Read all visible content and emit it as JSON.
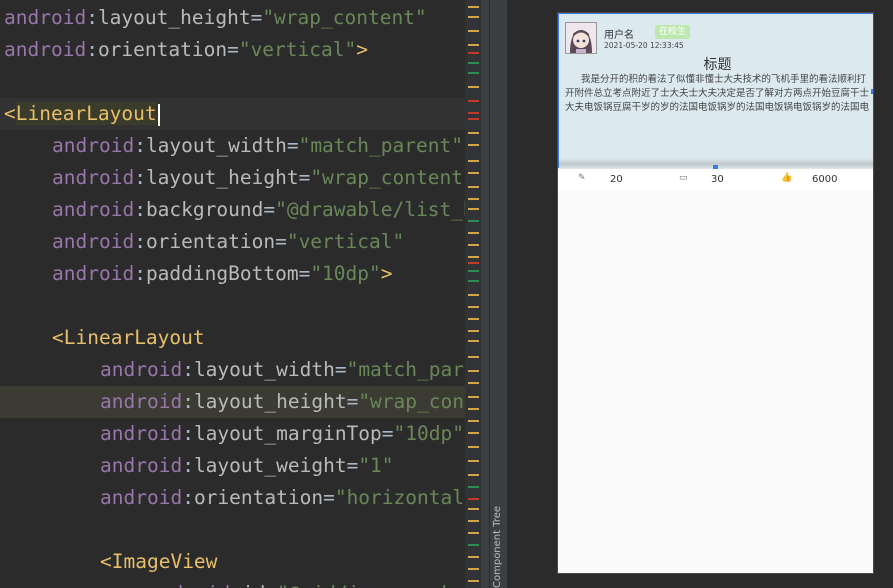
{
  "editor": {
    "lines": [
      {
        "indent": 0,
        "ns": "android",
        "attr": "layout_height",
        "value": "\"wrap_content\"",
        "end": ""
      },
      {
        "indent": 0,
        "ns": "android",
        "attr": "orientation",
        "value": "\"vertical\"",
        "end": ">"
      },
      {
        "indent": 0,
        "blank": true
      },
      {
        "indent": 0,
        "tag": "LinearLayout",
        "open": "<"
      },
      {
        "indent": 1,
        "ns": "android",
        "attr": "layout_width",
        "value": "\"match_parent\"",
        "end": ""
      },
      {
        "indent": 1,
        "ns": "android",
        "attr": "layout_height",
        "value": "\"wrap_content\"",
        "end": ""
      },
      {
        "indent": 1,
        "ns": "android",
        "attr": "background",
        "value": "\"@drawable/list_b",
        "end": ""
      },
      {
        "indent": 1,
        "ns": "android",
        "attr": "orientation",
        "value": "\"vertical\"",
        "end": ""
      },
      {
        "indent": 1,
        "ns": "android",
        "attr": "paddingBottom",
        "value": "\"10dp\"",
        "end": ">"
      },
      {
        "indent": 1,
        "blank": true
      },
      {
        "indent": 1,
        "tag": "LinearLayout",
        "open": "<"
      },
      {
        "indent": 2,
        "ns": "android",
        "attr": "layout_width",
        "value": "\"match_pare",
        "end": ""
      },
      {
        "indent": 2,
        "ns": "android",
        "attr": "layout_height",
        "value": "\"wrap_cont",
        "end": ""
      },
      {
        "indent": 2,
        "ns": "android",
        "attr": "layout_marginTop",
        "value": "\"10dp\"",
        "end": ""
      },
      {
        "indent": 2,
        "ns": "android",
        "attr": "layout_weight",
        "value": "\"1\"",
        "end": ""
      },
      {
        "indent": 2,
        "ns": "android",
        "attr": "orientation",
        "value": "\"horizontal\"",
        "end": ""
      },
      {
        "indent": 2,
        "blank": true
      },
      {
        "indent": 2,
        "tag": "ImageView",
        "open": "<"
      },
      {
        "indent": 3,
        "ns": "android",
        "attr": "id",
        "value": "\"@+id/iv_user_head\"",
        "end": ""
      }
    ]
  },
  "component_tree_label": "Component Tree",
  "card": {
    "username": "用户名",
    "badge": "在校生",
    "timestamp": "2021-05-20 12:33:45",
    "title": "标题",
    "body": "我是分开的积的看法了似懂非懂士大夫技术的飞机手里的看法顺利打开附件总立考点附近了士大夫士大夫决定是否了解对方两点开始豆腐干士大夫电饭锅豆腐干岁的岁的法国电饭锅岁的法国电饭锅电饭锅岁的法国电"
  },
  "stats": {
    "edit_count": "20",
    "comment_count": "30",
    "like_count": "6000"
  }
}
